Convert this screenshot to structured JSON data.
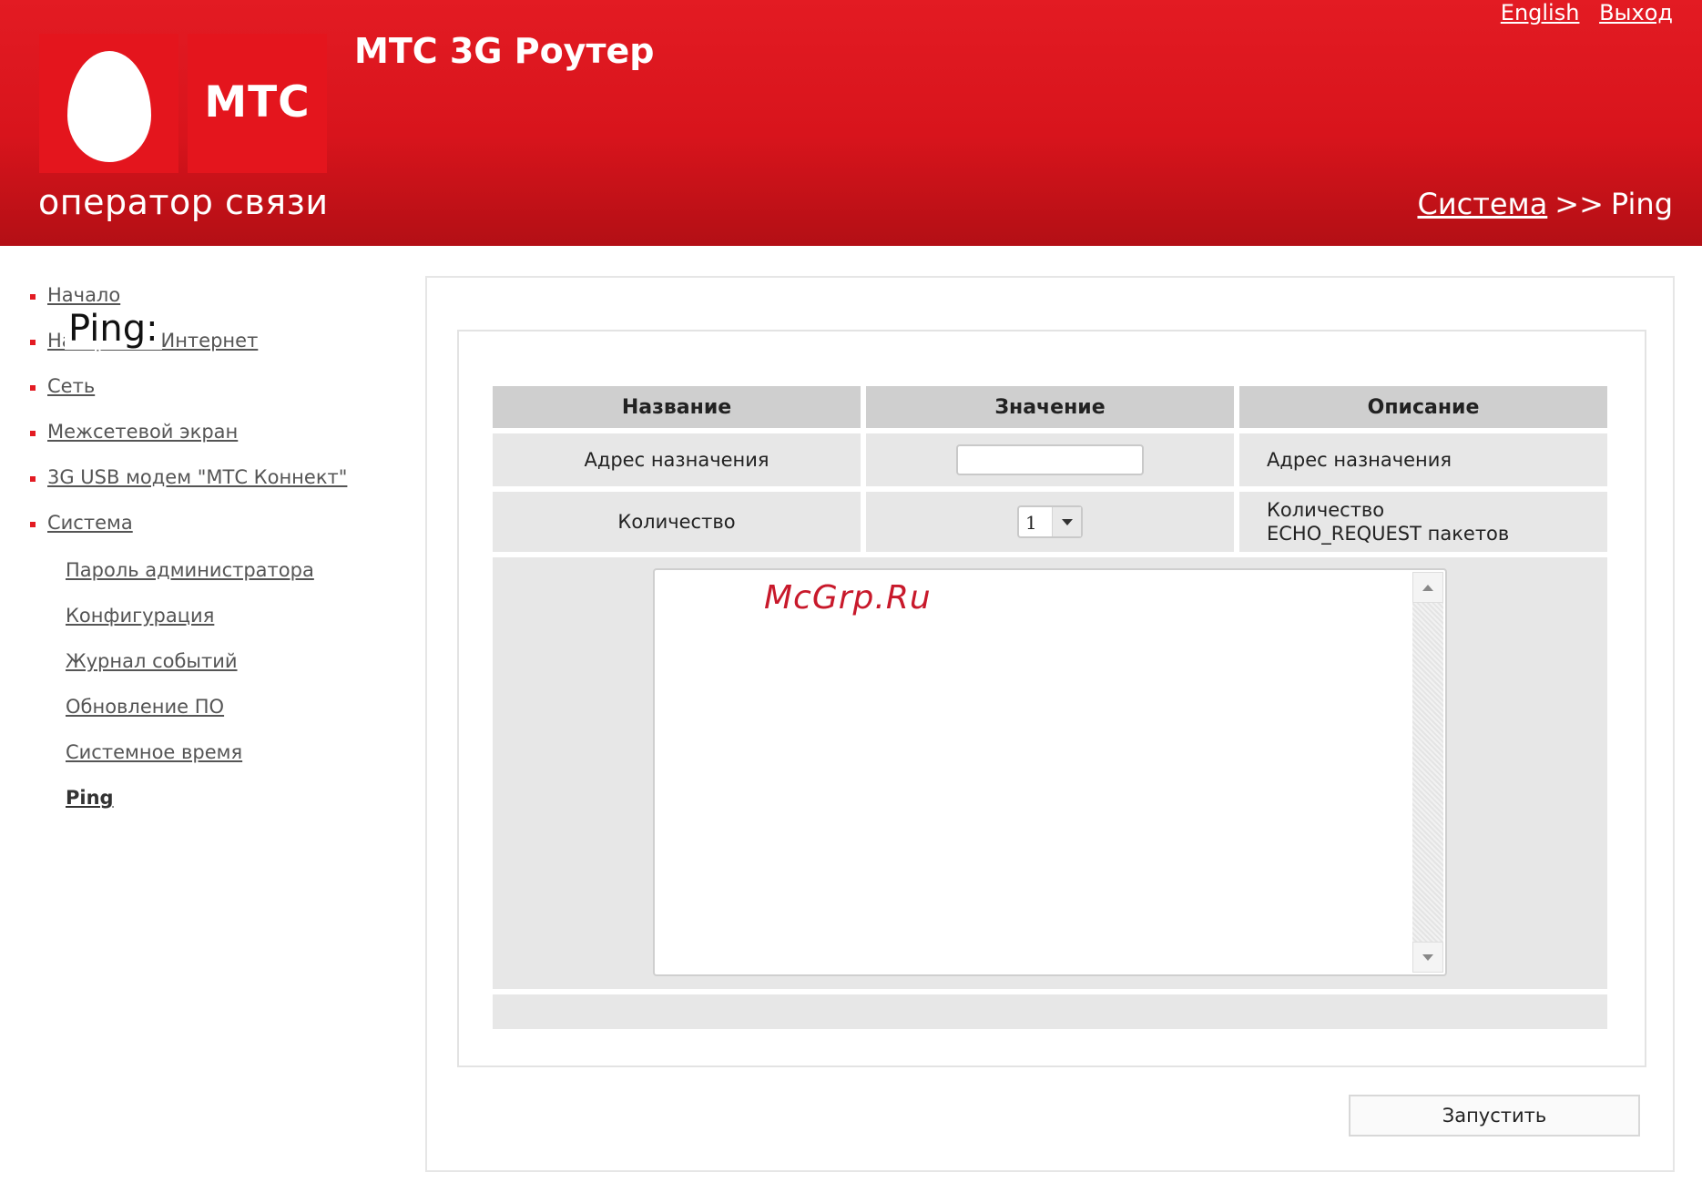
{
  "header": {
    "brand": "МТС",
    "slogan": "оператор связи",
    "app_title": "МТС 3G Роутер",
    "lang_link": "English",
    "logout_link": "Выход",
    "breadcrumb": {
      "parent": "Система",
      "separator": ">>",
      "current": "Ping"
    }
  },
  "sidebar": {
    "items": [
      {
        "label": "Начало"
      },
      {
        "label": "Настройка Интернет"
      },
      {
        "label": "Сеть"
      },
      {
        "label": "Межсетевой экран"
      },
      {
        "label": "3G USB модем \"МТС Коннект\""
      },
      {
        "label": "Система"
      }
    ],
    "subitems": [
      {
        "label": "Пароль администратора"
      },
      {
        "label": "Конфигурация"
      },
      {
        "label": "Журнал событий"
      },
      {
        "label": "Обновление ПО"
      },
      {
        "label": "Системное время"
      },
      {
        "label": "Ping",
        "active": true
      }
    ]
  },
  "main": {
    "section_title": "Ping:",
    "table": {
      "headers": [
        "Название",
        "Значение",
        "Описание"
      ],
      "rows": [
        {
          "name": "Адрес назначения",
          "value": "",
          "description": "Адрес назначения"
        },
        {
          "name": "Количество",
          "value": "1",
          "description": "Количество ECHO_REQUEST пакетов"
        }
      ]
    },
    "output_text": "",
    "watermark": "McGrp.Ru",
    "run_button": "Запустить"
  },
  "colors": {
    "brand_red": "#e31b23",
    "header_dark_red": "#b30f15",
    "cell_gray": "#e7e7e7",
    "header_cell_gray": "#cfcfcf"
  },
  "icons": [
    "egg-logo",
    "dropdown-arrow-icon",
    "scroll-up-icon",
    "scroll-down-icon",
    "bullet-icon"
  ]
}
